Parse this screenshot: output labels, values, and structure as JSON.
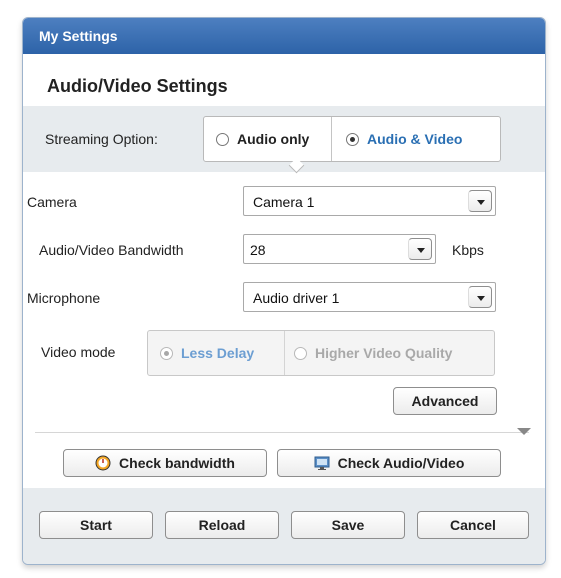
{
  "window": {
    "title": "My Settings"
  },
  "section": {
    "title": "Audio/Video Settings"
  },
  "streaming": {
    "label": "Streaming Option:",
    "options": [
      "Audio only",
      "Audio & Video"
    ],
    "selected": "Audio & Video"
  },
  "camera": {
    "label": "Camera",
    "value": "Camera 1"
  },
  "bandwidth": {
    "label": "Audio/Video Bandwidth",
    "value": "28",
    "unit": "Kbps"
  },
  "microphone": {
    "label": "Microphone",
    "value": "Audio driver 1"
  },
  "video_mode": {
    "label": "Video mode",
    "options": [
      "Less Delay",
      "Higher Video Quality"
    ],
    "selected": "Less Delay"
  },
  "buttons": {
    "advanced": "Advanced",
    "check_bandwidth": "Check bandwidth",
    "check_av": "Check Audio/Video",
    "start": "Start",
    "reload": "Reload",
    "save": "Save",
    "cancel": "Cancel"
  },
  "icons": {
    "bandwidth": "gauge-icon",
    "av": "monitor-icon"
  },
  "colors": {
    "titlebar": "#2d63a8",
    "selected_option": "#2a6fb3",
    "panel_band": "#e7ebee"
  }
}
